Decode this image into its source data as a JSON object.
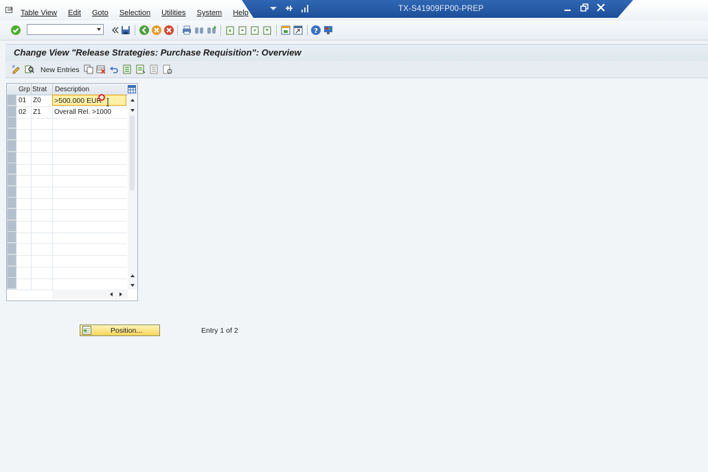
{
  "menu": {
    "items": [
      "Table View",
      "Edit",
      "Goto",
      "Selection",
      "Utilities",
      "System",
      "Help"
    ]
  },
  "window": {
    "title": "TX-S41909FP00-PREP"
  },
  "toolbar": {
    "command_field_value": "",
    "icons": [
      "enter-check-icon",
      "save-icon",
      "back-icon",
      "exit-icon",
      "cancel-icon",
      "print-icon",
      "find-icon",
      "find-next-icon",
      "first-page-icon",
      "previous-page-icon",
      "next-page-icon",
      "last-page-icon",
      "create-session-icon",
      "shortcut-icon",
      "help-icon",
      "customize-layout-icon"
    ]
  },
  "screen": {
    "title": "Change View \"Release Strategies: Purchase Requisition\": Overview"
  },
  "app_toolbar": {
    "new_entries_label": "New Entries",
    "icons": [
      "display-change-icon",
      "where-used-icon",
      "new-entries-icon",
      "copy-as-icon",
      "delete-icon",
      "undo-change-icon",
      "select-all-icon",
      "select-block-icon",
      "deselect-all-icon",
      "print-field-list-icon"
    ]
  },
  "table": {
    "columns": [
      "Grp",
      "Strat",
      "Description"
    ],
    "rows": [
      {
        "grp": "01",
        "strat": "Z0",
        "description": ">500.000 EUR"
      },
      {
        "grp": "02",
        "strat": "Z1",
        "description": "Overall Rel. >1000"
      }
    ],
    "empty_rows": 15
  },
  "footer": {
    "position_button_label": "Position...",
    "entry_info": "Entry 1 of 2"
  },
  "colors": {
    "title_bar": "#1d4f98",
    "edit_cell_bg": "#fdf0a8",
    "position_button_bg": "#f5d55a"
  }
}
